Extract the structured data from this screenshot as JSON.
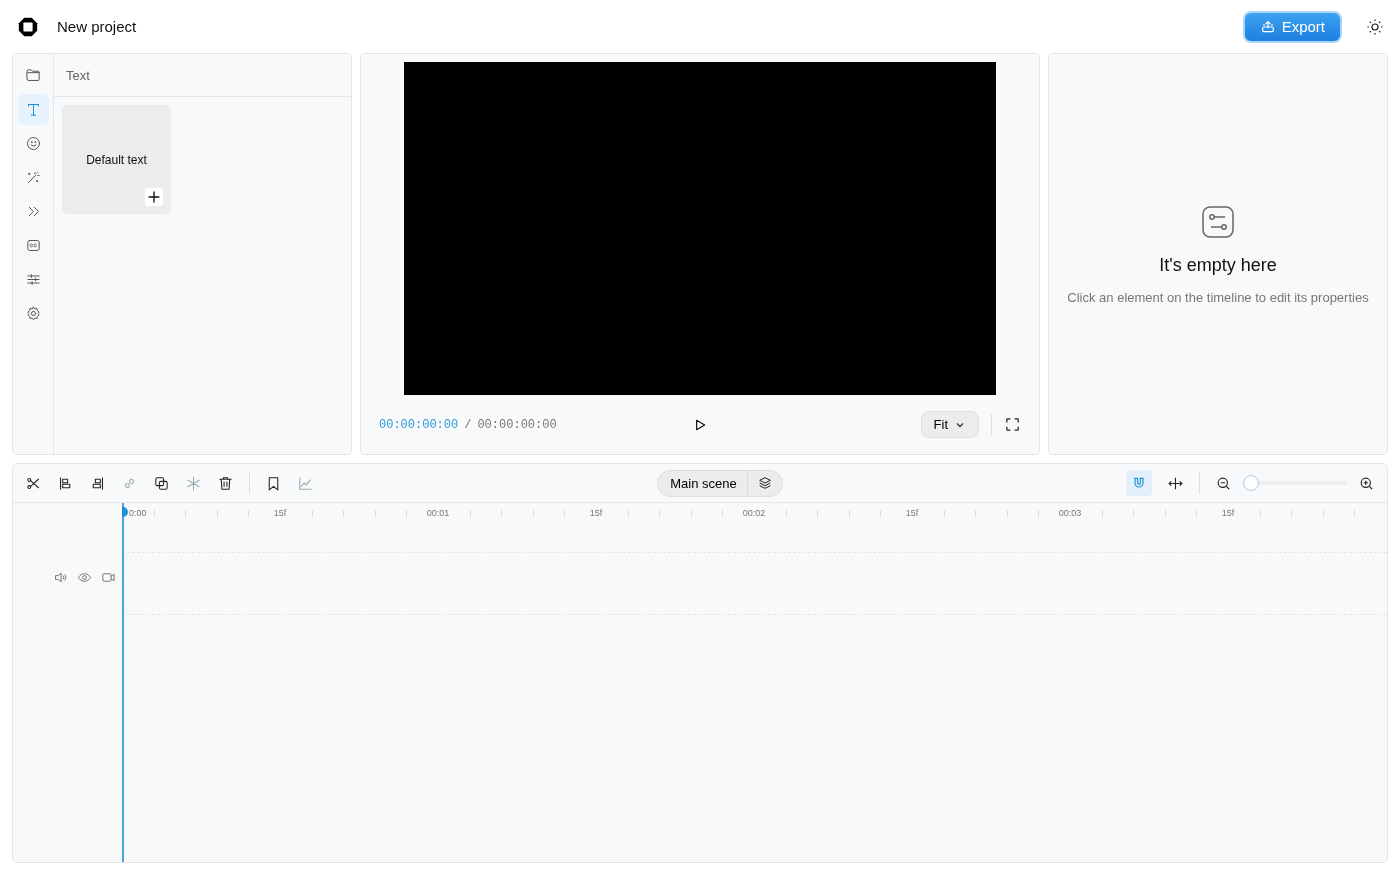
{
  "header": {
    "title": "New project",
    "export_label": "Export"
  },
  "sidebar": {
    "items": [
      {
        "kind": "folder",
        "selected": false
      },
      {
        "kind": "text",
        "selected": true
      },
      {
        "kind": "emoji",
        "selected": false
      },
      {
        "kind": "wand",
        "selected": false
      },
      {
        "kind": "transition",
        "selected": false
      },
      {
        "kind": "captions",
        "selected": false
      },
      {
        "kind": "adjust",
        "selected": false
      },
      {
        "kind": "settings",
        "selected": false
      }
    ]
  },
  "panel": {
    "title": "Text",
    "presets": [
      {
        "label": "Default text"
      }
    ]
  },
  "preview": {
    "current_time": "00:00:00:00",
    "separator": "/",
    "total_time": "00:00:00:00",
    "fit_label": "Fit"
  },
  "properties": {
    "title": "It's empty here",
    "message": "Click an element on the timeline to edit its properties"
  },
  "timeline": {
    "tools": [
      {
        "kind": "split",
        "disabled": false
      },
      {
        "kind": "align-left",
        "disabled": false
      },
      {
        "kind": "align-right",
        "disabled": false
      },
      {
        "kind": "link",
        "disabled": true
      },
      {
        "kind": "duplicate",
        "disabled": false
      },
      {
        "kind": "freeze",
        "disabled": true
      },
      {
        "kind": "delete",
        "disabled": false
      },
      {
        "kind": "marker",
        "disabled": false
      },
      {
        "kind": "graph",
        "disabled": true
      }
    ],
    "scene_label": "Main scene",
    "snap_on": true,
    "zoom": {
      "level": 0
    },
    "ruler": [
      "0:00",
      "15f",
      "00:01",
      "15f",
      "00:02",
      "15f",
      "00:03",
      "15f"
    ]
  }
}
